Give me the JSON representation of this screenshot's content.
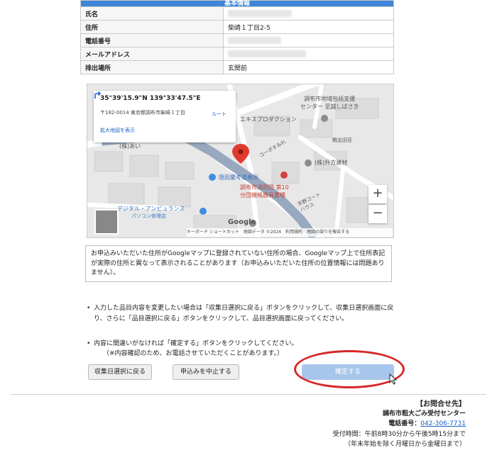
{
  "basic_info": {
    "header": "基本情報",
    "rows": [
      {
        "label": "氏名",
        "value": ""
      },
      {
        "label": "住所",
        "value": "柴崎１丁目2-5"
      },
      {
        "label": "電話番号",
        "value": ""
      },
      {
        "label": "メールアドレス",
        "value": ""
      },
      {
        "label": "排出場所",
        "value": "玄関前"
      }
    ]
  },
  "map": {
    "coords": "35°39'15.9\"N 139°33'47.5\"E",
    "address": "〒182-0014 東京都調布市柴崎１丁目",
    "enlarge_link": "拡大地図を表示",
    "route_label": "ルート",
    "labels": {
      "center": "調布市地域包括支援\nセンター 至誠しばさき",
      "ekisu": "エキスプロダクション",
      "kushida": "鴨志田荘",
      "kopo": "コーポすみれ",
      "ai": "(株)あい",
      "masu": "(株)升方建材",
      "clinic": "隠田慶考道奏所",
      "fire": "調布市消防団 第10",
      "fire2": "分団機械器具置場",
      "amano": "天野コート\nハウス",
      "digital": "デジタル・アンビュランス",
      "pc": "パソコン修理店",
      "google": "Google"
    },
    "zoom_in": "+",
    "zoom_out": "−",
    "attribution": "キーボード ショートカット　地図データ ©2024　利用規約　地図の誤りを報告する"
  },
  "notice": "お申込みいただいた住所がGoogleマップに登録されていない住所の場合、Googleマップ上で住所表記が実際の住所と異なって表示されることがあります（お申込みいただいた住所の位置情報には問題ありません）。",
  "bullets": [
    "入力した品目内容を変更したい場合は「収集日選択に戻る」ボタンをクリックして、収集日選択画面に戻り、さらに「品目選択に戻る」ボタンをクリックして、品目選択画面に戻ってください。",
    "内容に間違いがなければ「確定する」ボタンをクリックしてください。",
    "（※内容確認のため、お電話させていただくことがあります。）"
  ],
  "buttons": {
    "back": "収集日選択に戻る",
    "cancel": "申込みを中止する",
    "confirm": "確定する"
  },
  "contact": {
    "title": "【お問合せ先】",
    "org": "調布市粗大ごみ受付センター",
    "phone_label": "電話番号：",
    "phone": "042-306-7731",
    "hours": "受付時間：午前8時30分から午後5時15分まで",
    "hours_note": "（年末年始を除く月曜日から金曜日まで）"
  },
  "colors": {
    "header_blue": "#3d86d8",
    "confirm_button": "#a8c6ec",
    "highlight_ring": "#d62828",
    "link": "#1a62c6"
  }
}
